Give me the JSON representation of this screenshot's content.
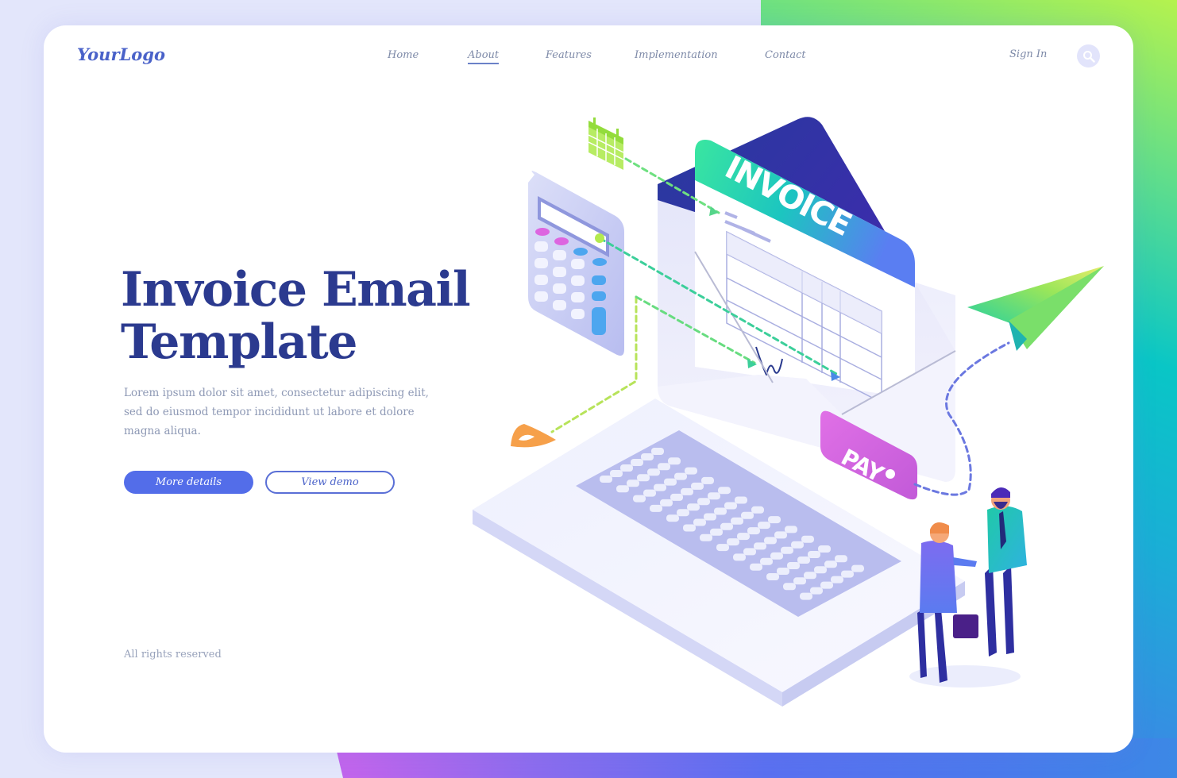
{
  "header": {
    "logo": "YourLogo",
    "nav": [
      {
        "label": "Home",
        "active": false
      },
      {
        "label": "About",
        "active": true
      },
      {
        "label": "Features",
        "active": false
      },
      {
        "label": "Implementation",
        "active": false
      },
      {
        "label": "Contact",
        "active": false
      }
    ],
    "sign_in": "Sign In",
    "search_icon": "search-icon"
  },
  "hero": {
    "title_line1": "Invoice Email",
    "title_line2": "Template",
    "description": "Lorem ipsum dolor sit amet, consectetur adipiscing elit, sed do eiusmod tempor incididunt ut labore et dolore magna aliqua.",
    "primary_button": "More details",
    "secondary_button": "View demo"
  },
  "footer": {
    "copyright": "All rights reserved"
  },
  "illustration": {
    "invoice_label": "INVOICE",
    "pay_label": "PAY",
    "icons": [
      "calendar-icon",
      "calculator-icon",
      "paper-plane-icon",
      "envelope-icon",
      "laptop-icon",
      "signature-icon",
      "shield-icon",
      "handshake-people-icon"
    ]
  },
  "colors": {
    "accent": "#536de9",
    "title": "#2b3a8f",
    "nav_text": "#7e8aa8",
    "pay_tag": "#d86ae6",
    "envelope_dark": "#2c2f9e"
  }
}
